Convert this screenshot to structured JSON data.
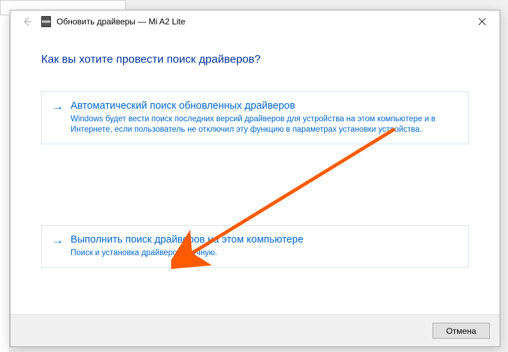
{
  "titlebar": {
    "title": "Обновить драйверы — Mi A2 Lite"
  },
  "heading": "Как вы хотите провести поиск драйверов?",
  "options": {
    "auto": {
      "title": "Автоматический поиск обновленных драйверов",
      "desc": "Windows будет вести поиск последних версий драйверов для устройства на этом компьютере и в Интернете, если пользователь не отключил эту функцию в параметрах установки устройства."
    },
    "manual": {
      "title": "Выполнить поиск драйверов на этом компьютере",
      "desc": "Поиск и установка драйверов вручную."
    }
  },
  "footer": {
    "cancel": "Отмена"
  }
}
